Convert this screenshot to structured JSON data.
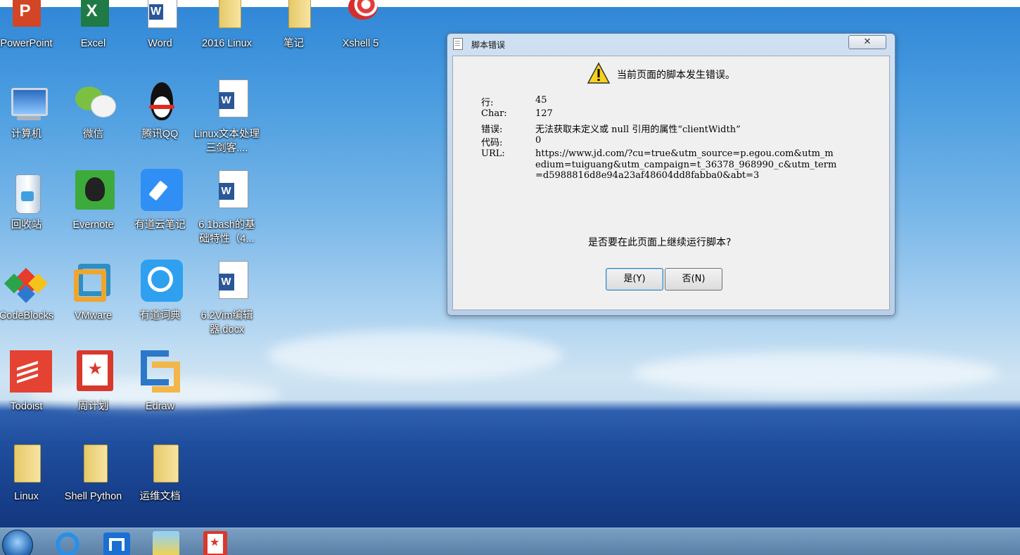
{
  "desktop": {
    "icons": [
      {
        "label": "PowerPoint",
        "icon": "powerpoint-icon"
      },
      {
        "label": "Excel",
        "icon": "excel-icon"
      },
      {
        "label": "Word",
        "icon": "word-icon"
      },
      {
        "label": "2016 Linux",
        "icon": "folder-icon"
      },
      {
        "label": "笔记",
        "icon": "folder-icon"
      },
      {
        "label": "Xshell 5",
        "icon": "xshell-icon"
      },
      {
        "label": "计算机",
        "icon": "computer-icon"
      },
      {
        "label": "微信",
        "icon": "wechat-icon"
      },
      {
        "label": "腾讯QQ",
        "icon": "qq-icon"
      },
      {
        "label": "Linux文本处理三剑客....",
        "icon": "word-document-icon"
      },
      {
        "label": "回收站",
        "icon": "recycle-bin-icon"
      },
      {
        "label": "Evernote",
        "icon": "evernote-icon"
      },
      {
        "label": "有道云笔记",
        "icon": "youdao-note-icon"
      },
      {
        "label": "6.1bash的基础特性（4...",
        "icon": "word-document-icon"
      },
      {
        "label": "CodeBlocks",
        "icon": "codeblocks-icon"
      },
      {
        "label": "VMware",
        "icon": "vmware-icon"
      },
      {
        "label": "有道词典",
        "icon": "youdao-dict-icon"
      },
      {
        "label": "6.2Vim编辑器.docx",
        "icon": "word-document-icon"
      },
      {
        "label": "Todoist",
        "icon": "todoist-icon"
      },
      {
        "label": "周计划",
        "icon": "weekly-plan-icon"
      },
      {
        "label": "Edraw",
        "icon": "edraw-icon"
      },
      {
        "label": "Linux",
        "icon": "folder-icon"
      },
      {
        "label": "Shell Python",
        "icon": "folder-icon"
      },
      {
        "label": "运维文档",
        "icon": "folder-icon"
      }
    ]
  },
  "dialog": {
    "title": "脚本错误",
    "close_label": "✕",
    "headline": "当前页面的脚本发生错误。",
    "fields": [
      {
        "key": "行:",
        "value": "45"
      },
      {
        "key": "Char:",
        "value": "127"
      },
      {
        "key": "错误:",
        "value": "无法获取未定义或 null 引用的属性“clientWidth”"
      },
      {
        "key": "代码:",
        "value": "0"
      },
      {
        "key": "URL:",
        "value": "https://www.jd.com/?cu=true&utm_source=p.egou.com&utm_medium=tuiguang&utm_campaign=t_36378_968990_c&utm_term=d5988816d8e94a23af48604dd8fabba0&abt=3"
      }
    ],
    "question": "是否要在此页面上继续运行脚本?",
    "yes_label": "是(Y)",
    "no_label": "否(N)"
  },
  "taskbar": {
    "apps": [
      "start-orb-icon",
      "qq-browser-icon",
      "maxthon-icon",
      "photo-app-icon",
      "weekly-plan-icon"
    ]
  }
}
